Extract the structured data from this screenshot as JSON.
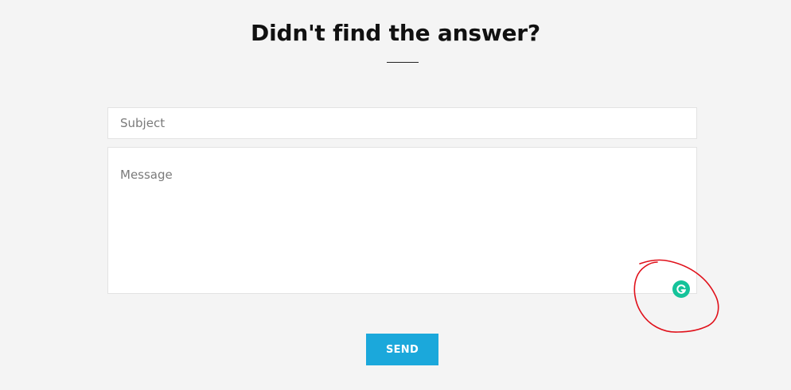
{
  "heading": "Didn't find the answer?",
  "form": {
    "subject_placeholder": "Subject",
    "subject_value": "",
    "message_placeholder": "Message",
    "message_value": "",
    "send_label": "SEND"
  },
  "icons": {
    "grammarly": "grammarly-icon"
  },
  "colors": {
    "page_background": "#f4f4f4",
    "send_button": "#1ba8db",
    "grammarly_badge": "#15c39a",
    "annotation_circle": "#e0101a"
  }
}
